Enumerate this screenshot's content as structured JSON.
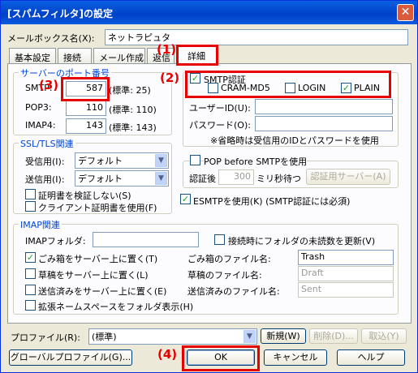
{
  "window": {
    "title": "[スパムフィルタ]の設定",
    "close": "✕"
  },
  "mailbox": {
    "label": "メールボックス名(X):",
    "value": "ネットラピュタ"
  },
  "tabs": [
    {
      "label": "基本設定"
    },
    {
      "label": "接続"
    },
    {
      "label": "メール作成"
    },
    {
      "label": "返信"
    },
    {
      "label": "詳細"
    }
  ],
  "server_ports": {
    "title": "サーバーのポート番号",
    "smtp": {
      "label": "SMTP:",
      "value": "587",
      "note": "(標準: 25)"
    },
    "pop3": {
      "label": "POP3:",
      "value": "110",
      "note": "(標準: 110)"
    },
    "imap4": {
      "label": "IMAP4:",
      "value": "143",
      "note": "(標準: 143)"
    }
  },
  "smtp_auth": {
    "checkbox": {
      "label": "SMTP認証",
      "checked": "✓"
    },
    "cram": {
      "label": "CRAM-MD5",
      "checked": ""
    },
    "login": {
      "label": "LOGIN",
      "checked": ""
    },
    "plain": {
      "label": "PLAIN",
      "checked": "✓"
    },
    "userid_label": "ユーザーID(U):",
    "password_label": "パスワード(O):",
    "note": "※省略時は受信用のIDとパスワードを使用"
  },
  "pop_before": {
    "label": "POP before SMTPを使用",
    "wait_label": "認証後",
    "wait_value": "300",
    "wait_unit": "ミリ秒待つ",
    "server_btn": "認証用サーバー(A)"
  },
  "esmtp": {
    "label": "ESMTPを使用(K) (SMTP認証には必須)",
    "checked": "✓"
  },
  "ssl": {
    "title": "SSL/TLS関連",
    "recv_label": "受信用(I):",
    "recv_value": "デフォルト",
    "send_label": "送信用(I):",
    "send_value": "デフォルト",
    "verify_label": "証明書を検証しない(S)",
    "client_label": "クライアント証明書を使用(F)"
  },
  "imap": {
    "title": "IMAP関連",
    "folder_label": "IMAPフォルダ:",
    "update_label": "接続時にフォルダの未読数を更新(V)",
    "trash_cb": "ごみ箱をサーバー上に置く(T)",
    "trash_name_label": "ごみ箱のファイル名:",
    "trash_value": "Trash",
    "draft_cb": "草稿をサーバー上に置く(L)",
    "draft_name_label": "草稿のファイル名:",
    "draft_value": "Draft",
    "sent_cb": "送信済みをサーバー上に置く(E)",
    "sent_name_label": "送信済みのファイル名:",
    "sent_value": "Sent",
    "ns_cb": "拡張ネームスペースをフォルダ表示(H)"
  },
  "profile": {
    "label": "プロファイル(R):",
    "value": "(標準)",
    "new_btn": "新規(W)",
    "del_btn": "削除(D)...",
    "take_btn": "取込(Y)"
  },
  "buttons": {
    "global": "グローバルプロファイル(G)...",
    "ok": "OK",
    "cancel": "キャンセル",
    "help": "ヘルプ"
  },
  "annotations": {
    "a1": "(1)",
    "a2": "(2)",
    "a3": "(3)",
    "a4": "(4)"
  }
}
